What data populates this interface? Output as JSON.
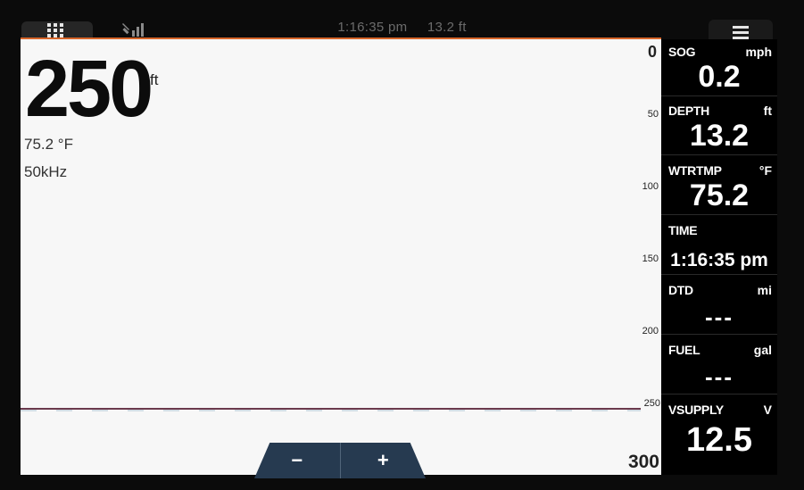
{
  "status_bar": {
    "time": "1:16:35 pm",
    "depth": "13.2 ft"
  },
  "sonar": {
    "range_value": "250",
    "range_unit": "ft",
    "water_temp": "75.2 °F",
    "frequency": "50kHz",
    "depth_scale": [
      "0",
      "50",
      "100",
      "150",
      "200",
      "250",
      "300"
    ]
  },
  "zoom": {
    "minus_label": "−",
    "plus_label": "+"
  },
  "data_panel": [
    {
      "label": "SOG",
      "unit": "mph",
      "value": "0.2"
    },
    {
      "label": "DEPTH",
      "unit": "ft",
      "value": "13.2"
    },
    {
      "label": "WTRTMP",
      "unit": "°F",
      "value": "75.2"
    },
    {
      "label": "TIME",
      "unit": "",
      "value": "1:16:35 pm"
    },
    {
      "label": "DTD",
      "unit": "mi",
      "value": "---"
    },
    {
      "label": "FUEL",
      "unit": "gal",
      "value": "---"
    },
    {
      "label": "VSUPPLY",
      "unit": "V",
      "value": "12.5"
    }
  ],
  "colors": {
    "accent_line": "#d7662a",
    "bottom_line": "#6b3a4d",
    "zoom_bg": "#263a50"
  }
}
